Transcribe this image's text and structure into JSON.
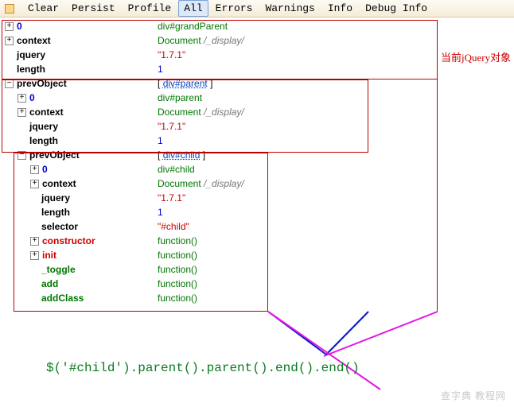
{
  "toolbar": {
    "items": [
      "Clear",
      "Persist",
      "Profile",
      "All",
      "Errors",
      "Warnings",
      "Info",
      "Debug Info"
    ],
    "active_index": 3
  },
  "note_right": "当前jQuery对象",
  "level0": {
    "zero": {
      "key": "0",
      "val": "div#grandParent"
    },
    "context": {
      "key": "context",
      "doc": "Document",
      "path": "/_display/"
    },
    "jquery": {
      "key": "jquery",
      "val": "\"1.7.1\""
    },
    "length": {
      "key": "length",
      "val": "1"
    },
    "prevObject": {
      "key": "prevObject",
      "bracketL": "[",
      "link": "div#parent",
      "bracketR": "]"
    }
  },
  "level1": {
    "zero": {
      "key": "0",
      "val": "div#parent"
    },
    "context": {
      "key": "context",
      "doc": "Document",
      "path": "/_display/"
    },
    "jquery": {
      "key": "jquery",
      "val": "\"1.7.1\""
    },
    "length": {
      "key": "length",
      "val": "1"
    },
    "prevObject": {
      "key": "prevObject",
      "bracketL": "[",
      "link": "div#child",
      "bracketR": "]"
    }
  },
  "level2": {
    "zero": {
      "key": "0",
      "val": "div#child"
    },
    "context": {
      "key": "context",
      "doc": "Document",
      "path": "/_display/"
    },
    "jquery": {
      "key": "jquery",
      "val": "\"1.7.1\""
    },
    "length": {
      "key": "length",
      "val": "1"
    },
    "selector": {
      "key": "selector",
      "val": "\"#child\""
    },
    "constructor": {
      "key": "constructor",
      "val": "function()"
    },
    "init": {
      "key": "init",
      "val": "function()"
    },
    "toggle": {
      "key": "_toggle",
      "val": "function()"
    },
    "add": {
      "key": "add",
      "val": "function()"
    },
    "addClass": {
      "key": "addClass",
      "val": "function()"
    }
  },
  "expression": "$('#child').parent().parent().end().end()",
  "watermark": "查字典  教程网"
}
